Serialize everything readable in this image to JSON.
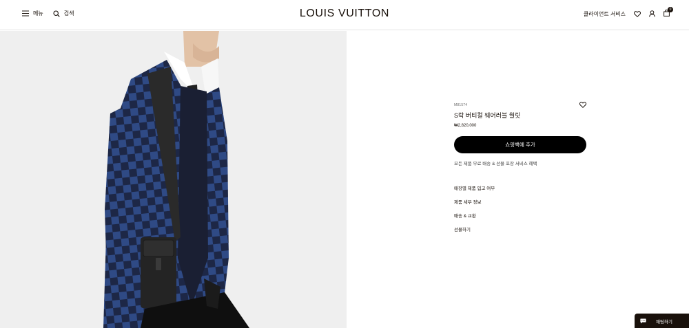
{
  "header": {
    "menu_label": "메뉴",
    "search_label": "검색",
    "logo": "LOUIS VUITTON",
    "client_services": "클라이언트 서비스",
    "bag_count": "0"
  },
  "product": {
    "sku": "M81574",
    "name": "S락 버티컬 웨어러블 월릿",
    "price": "₩2,820,000",
    "cta_label": "쇼핑백에 추가",
    "delivery_note": "모든 제품 무료 배송 & 선물 포장 서비스 혜택",
    "links": [
      "매장별 제품 입고 여부",
      "제품 세부 정보",
      "배송 & 교환",
      "선물하기"
    ]
  },
  "chat": {
    "label": "채팅하기"
  },
  "colors": {
    "ink": "#19110b",
    "panel": "#efefef",
    "cta": "#000000"
  },
  "icons": [
    "menu-icon",
    "search-icon",
    "heart-icon",
    "user-icon",
    "bag-icon",
    "chat-icon"
  ]
}
